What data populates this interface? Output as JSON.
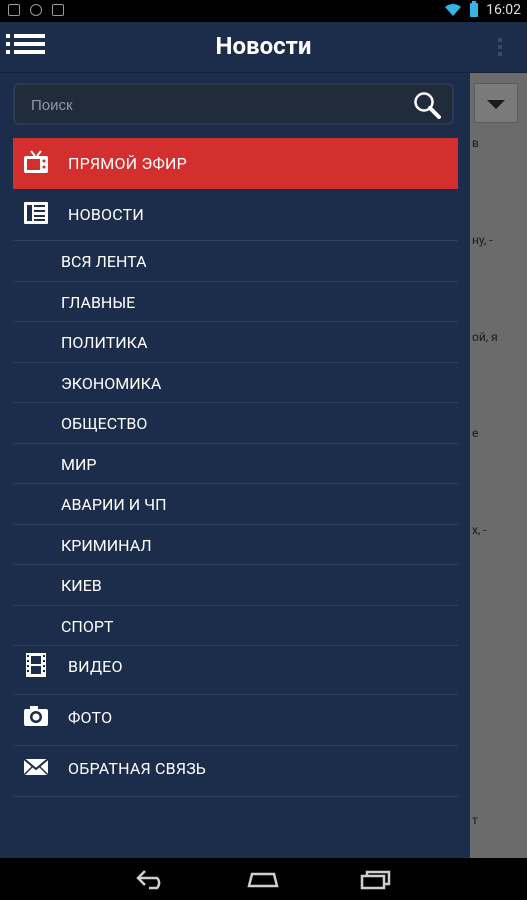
{
  "status_bar": {
    "time": "16:02"
  },
  "app_bar": {
    "title": "Новости"
  },
  "search": {
    "placeholder": "Поиск",
    "value": ""
  },
  "drawer": {
    "items": [
      {
        "label": "ПРЯМОЙ ЭФИР",
        "icon": "tv-icon",
        "active": true
      },
      {
        "label": "НОВОСТИ",
        "icon": "newspaper-icon",
        "active": false
      }
    ],
    "sub_items": [
      {
        "label": "ВСЯ ЛЕНТА"
      },
      {
        "label": "ГЛАВНЫЕ"
      },
      {
        "label": "ПОЛИТИКА"
      },
      {
        "label": "ЭКОНОМИКА"
      },
      {
        "label": "ОБЩЕСТВО"
      },
      {
        "label": "МИР"
      },
      {
        "label": "АВАРИИ И ЧП"
      },
      {
        "label": "КРИМИНАЛ"
      },
      {
        "label": "КИЕВ"
      },
      {
        "label": "СПОРТ"
      }
    ],
    "bottom_items": [
      {
        "label": "ВИДЕО",
        "icon": "film-icon"
      },
      {
        "label": "ФОТО",
        "icon": "camera-icon"
      },
      {
        "label": "ОБРАТНАЯ СВЯЗЬ",
        "icon": "envelope-icon"
      }
    ]
  },
  "content_peek": [
    "в",
    "ну, -",
    "ой, я",
    "е",
    "х, -",
    "т"
  ],
  "colors": {
    "drawer_bg": "#1b2d4a",
    "active_item": "#d32f2f",
    "content_bg": "#6b6b6b"
  }
}
